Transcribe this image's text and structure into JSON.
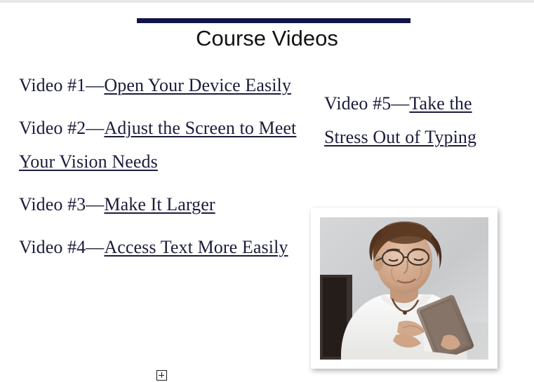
{
  "slide": {
    "title": "Course Videos",
    "accent_color": "#12134a",
    "text_color": "#1c1c3c",
    "background_color": "#ffffff"
  },
  "columns": {
    "left": [
      {
        "label": "Video #1—",
        "link": "Open Your Device Easily"
      },
      {
        "label": "Video #2—",
        "link": "Adjust the Screen to Meet Your Vision Needs"
      },
      {
        "label": "Video #3—",
        "link": "Make It Larger"
      },
      {
        "label": "Video #4—",
        "link": "Access Text More Easily"
      }
    ],
    "right": [
      {
        "label": "Video #5—",
        "link": "Take the Stress Out of Typing"
      }
    ]
  },
  "photo": {
    "alt": "Elderly woman with glasses seated, smiling while using a tablet computer",
    "frame_color": "#ffffff",
    "background_color": "#c9cbcd"
  },
  "controls": {
    "expand_icon": "plus-in-square"
  }
}
